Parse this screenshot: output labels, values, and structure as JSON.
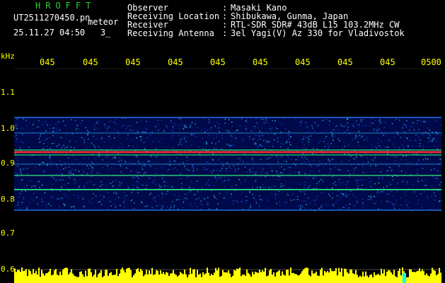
{
  "app": {
    "brand": "HROFFT",
    "mode": "meteor"
  },
  "file": {
    "name": "UT2511270450.pn",
    "suffix": "meteor",
    "datetime": "25.11.27 04:50",
    "extra": "3_"
  },
  "info": [
    {
      "label": "Observer",
      "value": "Masaki Kano"
    },
    {
      "label": "Receiving Location",
      "value": "Shibukawa, Gunma, Japan"
    },
    {
      "label": "Receiver",
      "value": "RTL-SDR SDR# 43dB L15 103.2MHz CW"
    },
    {
      "label": "Receiving Antenna",
      "value": "3el Yagi(V) Az 330 for Vladivostok"
    }
  ],
  "separator": ":",
  "axis": {
    "unit": "kHz",
    "time_ticks": [
      "045",
      "045",
      "045",
      "045",
      "045",
      "045",
      "045",
      "045",
      "045",
      "0500"
    ],
    "freq_ticks": [
      "1.1",
      "1.0",
      "0.9",
      "0.8",
      "0.7",
      "0.6"
    ]
  },
  "colors": {
    "brand": "#2fd12f",
    "axis": "#ffff00",
    "signal_peak": "#ff3030",
    "background": "#000000"
  }
}
